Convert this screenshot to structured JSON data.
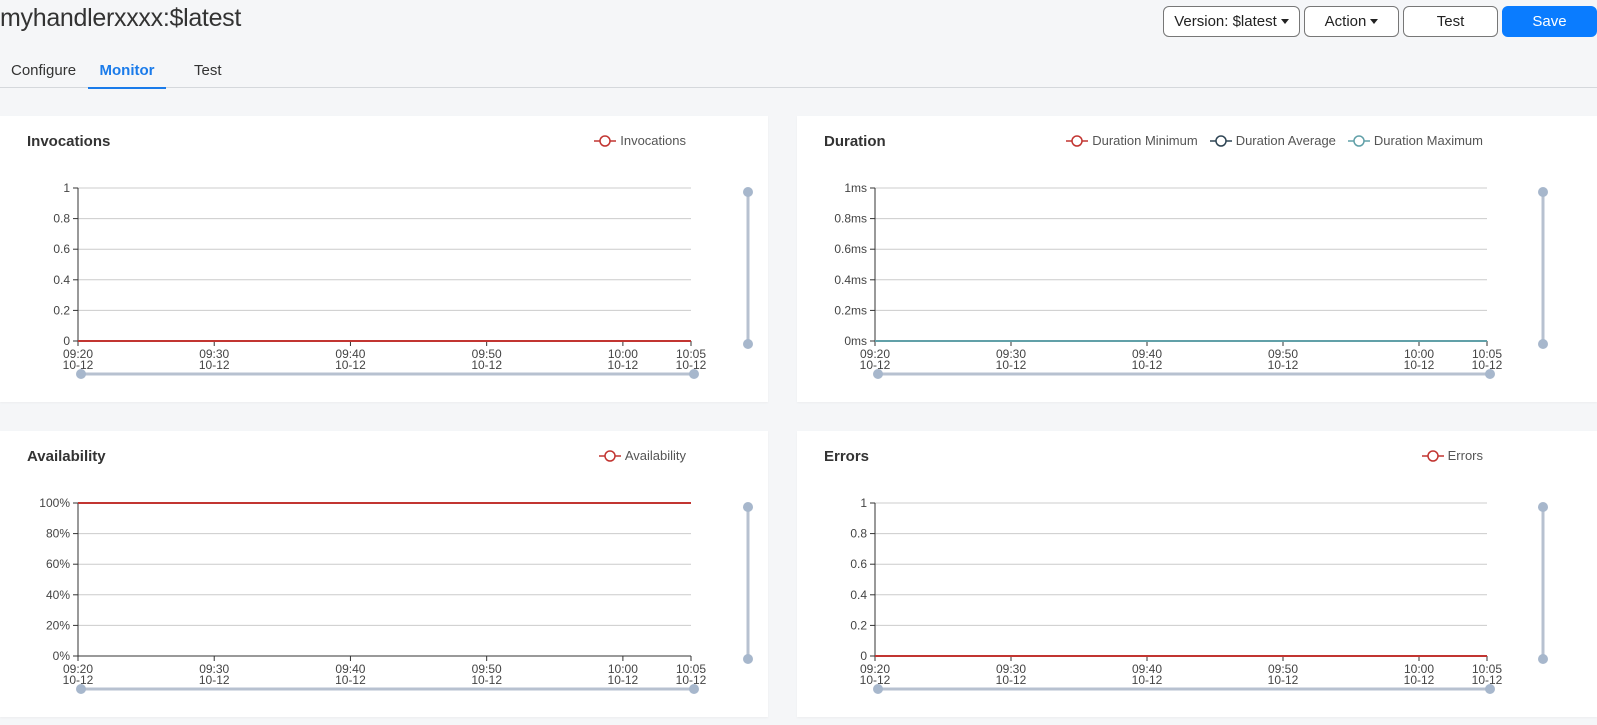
{
  "header": {
    "title": "myhandlerxxxx:$latest",
    "buttons": {
      "version": "Version: $latest",
      "action": "Action",
      "test": "Test",
      "save": "Save"
    }
  },
  "tabs": [
    {
      "label": "Configure",
      "active": false
    },
    {
      "label": "Monitor",
      "active": true
    },
    {
      "label": "Test",
      "active": false
    }
  ],
  "colors": {
    "accent": "#0a7cff",
    "series_red": "#c23531",
    "series_dark": "#2f4554",
    "series_teal": "#61a0a8",
    "grid": "#cccccc",
    "zoom_slider": "#b7c1d0"
  },
  "chart_data": [
    {
      "type": "line",
      "title": "Invocations",
      "legend": [
        {
          "name": "Invocations",
          "color": "#c23531"
        }
      ],
      "legend_position": "top-right",
      "x_ticks": [
        {
          "time": "09:20",
          "date": "10-12"
        },
        {
          "time": "09:30",
          "date": "10-12"
        },
        {
          "time": "09:40",
          "date": "10-12"
        },
        {
          "time": "09:50",
          "date": "10-12"
        },
        {
          "time": "10:00",
          "date": "10-12"
        },
        {
          "time": "10:05",
          "date": "10-12"
        }
      ],
      "x_minutes": [
        0,
        10,
        20,
        30,
        40,
        45
      ],
      "y_ticks": [
        "0",
        "0.2",
        "0.4",
        "0.6",
        "0.8",
        "1"
      ],
      "ylim": [
        0,
        1
      ],
      "grid": true,
      "series": [
        {
          "name": "Invocations",
          "color": "#c23531",
          "x": [
            0,
            45
          ],
          "values": [
            0,
            0
          ]
        }
      ]
    },
    {
      "type": "line",
      "title": "Duration",
      "legend": [
        {
          "name": "Duration Minimum",
          "color": "#c23531"
        },
        {
          "name": "Duration Average",
          "color": "#2f4554"
        },
        {
          "name": "Duration Maximum",
          "color": "#61a0a8"
        }
      ],
      "legend_position": "top-right",
      "x_ticks": [
        {
          "time": "09:20",
          "date": "10-12"
        },
        {
          "time": "09:30",
          "date": "10-12"
        },
        {
          "time": "09:40",
          "date": "10-12"
        },
        {
          "time": "09:50",
          "date": "10-12"
        },
        {
          "time": "10:00",
          "date": "10-12"
        },
        {
          "time": "10:05",
          "date": "10-12"
        }
      ],
      "x_minutes": [
        0,
        10,
        20,
        30,
        40,
        45
      ],
      "y_ticks": [
        "0ms",
        "0.2ms",
        "0.4ms",
        "0.6ms",
        "0.8ms",
        "1ms"
      ],
      "ylim": [
        0,
        1
      ],
      "ylabel_unit": "ms",
      "grid": true,
      "series": [
        {
          "name": "Duration Minimum",
          "color": "#c23531",
          "x": [
            0,
            45
          ],
          "values": [
            0,
            0
          ]
        },
        {
          "name": "Duration Average",
          "color": "#2f4554",
          "x": [
            0,
            45
          ],
          "values": [
            0,
            0
          ]
        },
        {
          "name": "Duration Maximum",
          "color": "#61a0a8",
          "x": [
            0,
            45
          ],
          "values": [
            0,
            0
          ]
        }
      ]
    },
    {
      "type": "line",
      "title": "Availability",
      "legend": [
        {
          "name": "Availability",
          "color": "#c23531"
        }
      ],
      "legend_position": "top-right",
      "x_ticks": [
        {
          "time": "09:20",
          "date": "10-12"
        },
        {
          "time": "09:30",
          "date": "10-12"
        },
        {
          "time": "09:40",
          "date": "10-12"
        },
        {
          "time": "09:50",
          "date": "10-12"
        },
        {
          "time": "10:00",
          "date": "10-12"
        },
        {
          "time": "10:05",
          "date": "10-12"
        }
      ],
      "x_minutes": [
        0,
        10,
        20,
        30,
        40,
        45
      ],
      "y_ticks": [
        "0%",
        "20%",
        "40%",
        "60%",
        "80%",
        "100%"
      ],
      "ylim": [
        0,
        100
      ],
      "grid": true,
      "series": [
        {
          "name": "Availability",
          "color": "#c23531",
          "x": [
            0,
            45
          ],
          "values": [
            100,
            100
          ]
        }
      ]
    },
    {
      "type": "line",
      "title": "Errors",
      "legend": [
        {
          "name": "Errors",
          "color": "#c23531"
        }
      ],
      "legend_position": "top-right",
      "x_ticks": [
        {
          "time": "09:20",
          "date": "10-12"
        },
        {
          "time": "09:30",
          "date": "10-12"
        },
        {
          "time": "09:40",
          "date": "10-12"
        },
        {
          "time": "09:50",
          "date": "10-12"
        },
        {
          "time": "10:00",
          "date": "10-12"
        },
        {
          "time": "10:05",
          "date": "10-12"
        }
      ],
      "x_minutes": [
        0,
        10,
        20,
        30,
        40,
        45
      ],
      "y_ticks": [
        "0",
        "0.2",
        "0.4",
        "0.6",
        "0.8",
        "1"
      ],
      "ylim": [
        0,
        1
      ],
      "grid": true,
      "series": [
        {
          "name": "Errors",
          "color": "#c23531",
          "x": [
            0,
            45
          ],
          "values": [
            0,
            0
          ]
        }
      ]
    }
  ]
}
